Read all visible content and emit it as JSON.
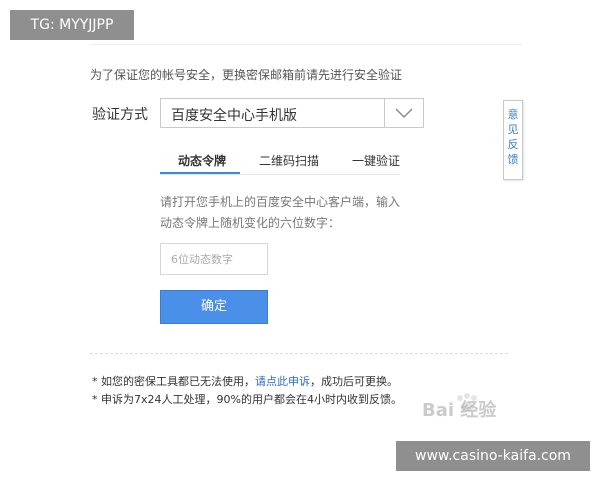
{
  "overlay": {
    "tg_badge": "TG: MYYJJPP",
    "site_badge": "www.casino-kaifa.com",
    "watermark_text": "Bai 经验"
  },
  "notice": "为了保证您的帐号安全，更换密保邮箱前请先进行安全验证",
  "verify": {
    "label": "验证方式",
    "selected": "百度安全中心手机版"
  },
  "tabs": [
    {
      "label": "动态令牌",
      "active": true
    },
    {
      "label": "二维码扫描",
      "active": false
    },
    {
      "label": "一键验证",
      "active": false
    }
  ],
  "instruction": "请打开您手机上的百度安全中心客户端，输入动态令牌上随机变化的六位数字：",
  "code_input": {
    "placeholder": "6位动态数字",
    "value": ""
  },
  "confirm_label": "确定",
  "notes": {
    "note1_prefix": "* 如您的密保工具都已无法使用，",
    "note1_link": "请点此申诉",
    "note1_suffix": "，成功后可更换。",
    "note2": "* 申诉为7x24人工处理，90%的用户都会在4小时内收到反馈。"
  },
  "feedback_tab": "意见反馈",
  "colors": {
    "accent": "#4a8fe8",
    "link": "#2a6bc9",
    "badge_bg": "#8f8f8f"
  },
  "icons": {
    "select_arrow": "chevron-down-icon",
    "watermark": "paw-icon"
  }
}
